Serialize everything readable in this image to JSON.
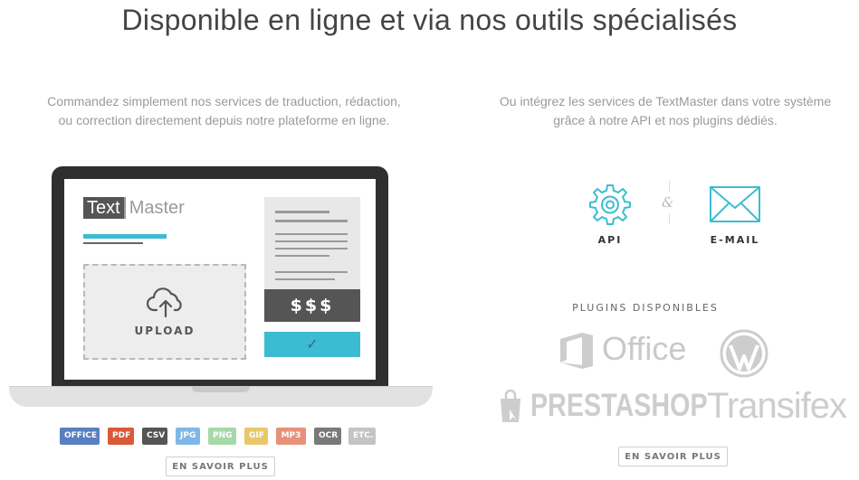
{
  "heading": "Disponible en ligne et via nos outils spécialisés",
  "left": {
    "description_line1": "Commandez simplement nos services de traduction, rédaction,",
    "description_line2": "ou correction directement depuis notre plateforme en ligne.",
    "logo_text": "Text",
    "logo_master": "Master",
    "upload_label": "UPLOAD",
    "price_label": "$$$",
    "check_icon": "check-icon",
    "formats": [
      {
        "label": "OFFICE",
        "color": "#5a7fc0"
      },
      {
        "label": "PDF",
        "color": "#d9593b"
      },
      {
        "label": "CSV",
        "color": "#555555"
      },
      {
        "label": "JPG",
        "color": "#7fb8e8"
      },
      {
        "label": "PNG",
        "color": "#a8d8a8"
      },
      {
        "label": "GIF",
        "color": "#e8c86a"
      },
      {
        "label": "MP3",
        "color": "#e8907a"
      },
      {
        "label": "OCR",
        "color": "#7a7a7a"
      },
      {
        "label": "ETC.",
        "color": "#c4c4c4"
      }
    ],
    "learn_more": "EN SAVOIR PLUS"
  },
  "right": {
    "description_line1": "Ou intégrez les services de TextMaster dans votre système",
    "description_line2": "grâce à notre API et nos plugins dédiés.",
    "api_label": "API",
    "ampersand": "&",
    "email_label": "E-MAIL",
    "plugins_title": "PLUGINS DISPONIBLES",
    "plugins": {
      "office": "Office",
      "wordpress_icon": "wordpress-icon",
      "prestashop": "PRESTASHOP",
      "transifex": "Transifex"
    },
    "learn_more": "EN SAVOIR PLUS"
  },
  "colors": {
    "accent": "#3cbcd2",
    "dark": "#555555",
    "plugin_gray": "#cdcdcd"
  }
}
